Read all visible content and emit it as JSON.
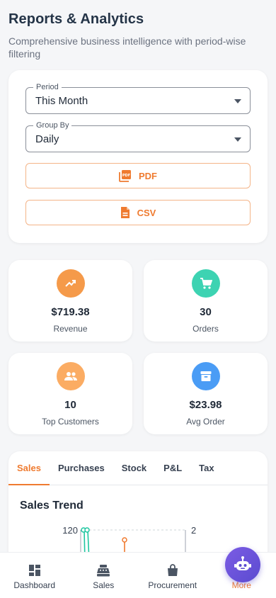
{
  "header": {
    "title": "Reports & Analytics",
    "subtitle": "Comprehensive business intelligence with period-wise filtering"
  },
  "filters": {
    "period": {
      "label": "Period",
      "value": "This Month"
    },
    "group_by": {
      "label": "Group By",
      "value": "Daily"
    },
    "export_pdf_label": "PDF",
    "export_csv_label": "CSV"
  },
  "stats": [
    {
      "value": "$719.38",
      "label": "Revenue",
      "icon": "trending-up-icon",
      "color": "#f59a4a"
    },
    {
      "value": "30",
      "label": "Orders",
      "icon": "cart-icon",
      "color": "#3dd3b2"
    },
    {
      "value": "10",
      "label": "Top Customers",
      "icon": "people-icon",
      "color": "#fbac63"
    },
    {
      "value": "$23.98",
      "label": "Avg Order",
      "icon": "archive-icon",
      "color": "#4a9cf5"
    }
  ],
  "tabs": [
    "Sales",
    "Purchases",
    "Stock",
    "P&L",
    "Tax"
  ],
  "active_tab": "Sales",
  "chart": {
    "title": "Sales Trend",
    "left_axis_top_tick": "120",
    "right_axis_top_tick": "2"
  },
  "bottom_nav": [
    {
      "label": "Dashboard",
      "icon": "dashboard-icon"
    },
    {
      "label": "Sales",
      "icon": "cash-register-icon"
    },
    {
      "label": "Procurement",
      "icon": "shopping-bag-icon"
    },
    {
      "label": "More",
      "icon": "more-icon"
    }
  ],
  "colors": {
    "accent": "#ef7b30",
    "fab": "#6a53dc"
  }
}
